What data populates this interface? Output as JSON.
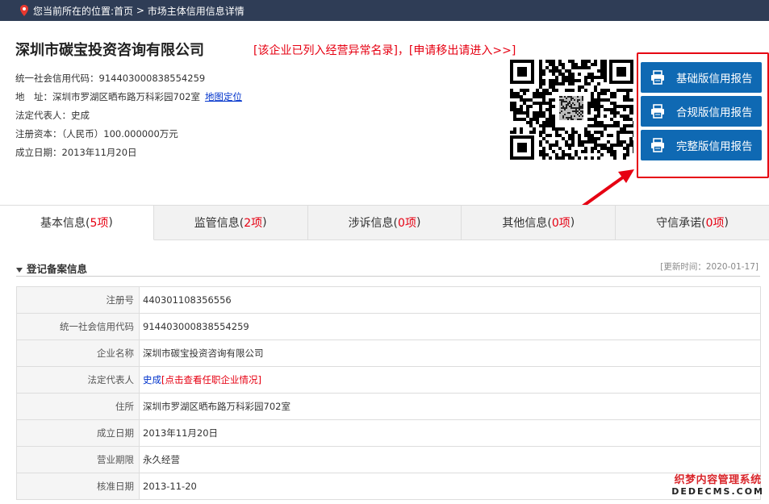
{
  "breadcrumb": {
    "prefix": "您当前所在的位置:",
    "home": "首页",
    "sep": " > ",
    "current": "市场主体信用信息详情"
  },
  "company": {
    "name": "深圳市碳宝投资咨询有限公司",
    "abnormal_notice": "[该企业已列入经营异常名录]，[申请移出请进入>>]",
    "credit_code_line": "统一社会信用代码：914403000838554259",
    "address_line": "地　址：深圳市罗湖区晒布路万科彩园702室",
    "map_link": "地图定位",
    "legal_rep_line": "法定代表人：史成",
    "capital_line": "注册资本：（人民币）100.000000万元",
    "founded_line": "成立日期：2013年11月20日"
  },
  "reports": [
    {
      "label": "基础版信用报告",
      "icon": "printer-icon"
    },
    {
      "label": "合规版信用报告",
      "icon": "printer-icon"
    },
    {
      "label": "完整版信用报告",
      "icon": "printer-icon"
    }
  ],
  "tabs": [
    {
      "label": "基本信息(",
      "count": "5项",
      "close": ")"
    },
    {
      "label": "监管信息(",
      "count": "2项",
      "close": ")"
    },
    {
      "label": "涉诉信息(",
      "count": "0项",
      "close": ")"
    },
    {
      "label": "其他信息(",
      "count": "0项",
      "close": ")"
    },
    {
      "label": "守信承诺(",
      "count": "0项",
      "close": ")"
    }
  ],
  "section": {
    "title": "登记备案信息",
    "update_time": "[更新时间：2020-01-17]"
  },
  "table": {
    "rows": [
      {
        "key": "注册号",
        "value": "440301108356556"
      },
      {
        "key": "统一社会信用代码",
        "value": "914403000838554259"
      },
      {
        "key": "企业名称",
        "value": "深圳市碳宝投资咨询有限公司"
      },
      {
        "key": "法定代表人",
        "value": "史成",
        "link": "[点击查看任职企业情况]"
      },
      {
        "key": "住所",
        "value": "深圳市罗湖区晒布路万科彩园702室"
      },
      {
        "key": "成立日期",
        "value": "2013年11月20日"
      },
      {
        "key": "营业期限",
        "value": "永久经营"
      },
      {
        "key": "核准日期",
        "value": "2013-11-20"
      }
    ]
  },
  "watermark": {
    "line1": "织梦内容管理系统",
    "line2": "DEDECMS.COM"
  },
  "colors": {
    "topbar": "#2f3d56",
    "button": "#0f69b3",
    "alert": "#e60012",
    "link": "#0033cc"
  }
}
